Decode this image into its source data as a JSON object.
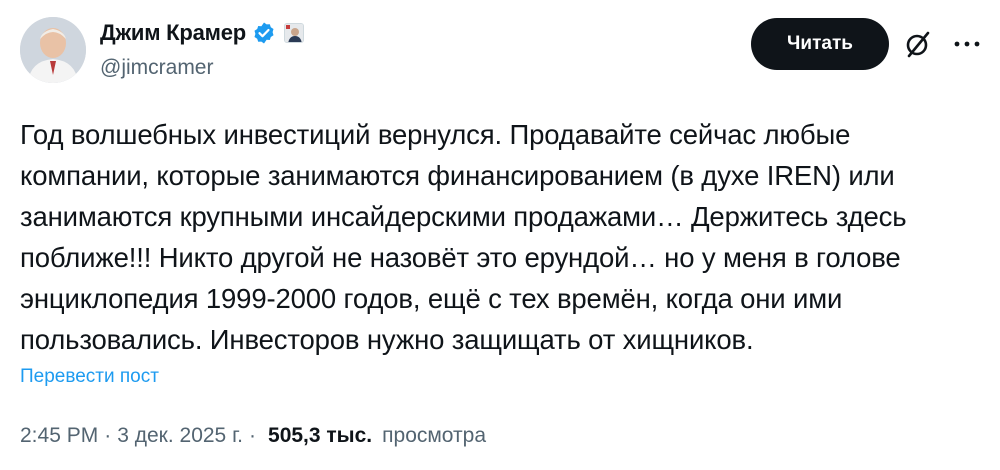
{
  "author": {
    "name": "Джим Крамер",
    "handle": "@jimcramer",
    "verified": true
  },
  "actions": {
    "read_label": "Читать"
  },
  "tweet": {
    "text": "Год волшебных инвестиций вернулся. Продавайте сейчас любые\nкомпании, которые занимаются финансированием (в духе IREN) или\nзанимаются крупными инсайдерскими продажами… Держитесь здесь\nпоближе!!! Никто другой не назовёт это ерундой… но у меня в голове\nэнциклопедия 1999-2000 годов, ещё с тех времён, когда они ими\nпользовались. Инвесторов нужно защищать от хищников.",
    "translate_label": "Перевести пост"
  },
  "meta": {
    "time": "2:45 PM",
    "separator": "·",
    "date": "3 дек. 2025 г.",
    "separator2": "·",
    "views_count": "505,3 тыс.",
    "views_label": "просмотра"
  },
  "colors": {
    "accent": "#1d9bf0",
    "text": "#0f1419",
    "secondary": "#536471",
    "button_bg": "#0f1419"
  },
  "icons": [
    "avatar",
    "verified-badge-icon",
    "affiliate-badge-icon",
    "grok-icon",
    "more-icon"
  ]
}
